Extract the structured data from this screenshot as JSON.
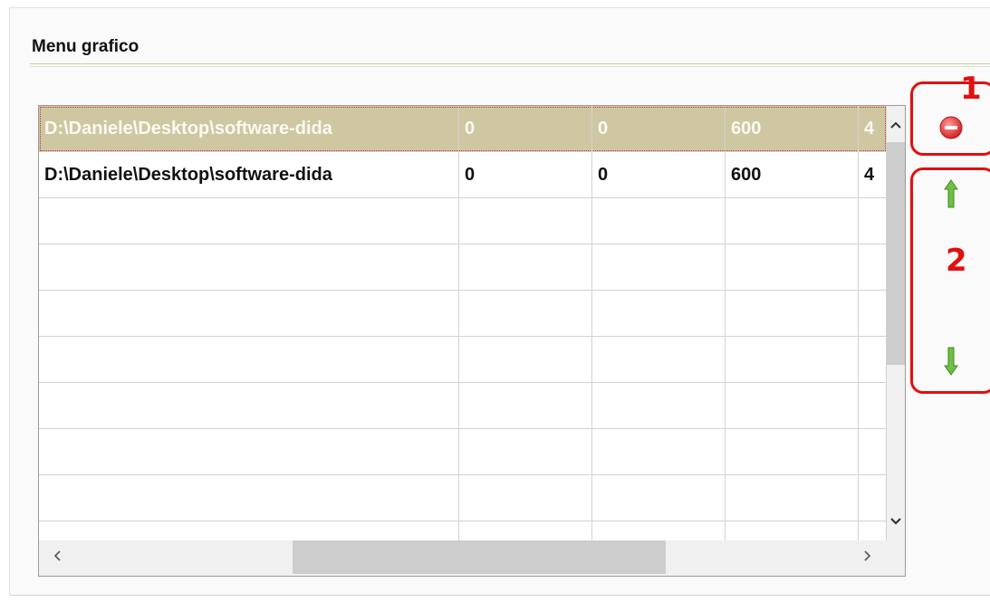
{
  "group_title": "Menu grafico",
  "grid": {
    "rows": [
      {
        "path": "D:\\Daniele\\Desktop\\software-dida",
        "c1": "0",
        "c2": "0",
        "c3": "600",
        "c4": "4"
      },
      {
        "path": "D:\\Daniele\\Desktop\\software-dida",
        "c1": "0",
        "c2": "0",
        "c3": "600",
        "c4": "4"
      }
    ],
    "selected_row": 0
  },
  "scrollbars": {
    "up": "^",
    "down": "v",
    "left": "<",
    "right": ">"
  },
  "annotations": {
    "box1_label": "1",
    "box2_label": "2",
    "color": "#e01010"
  },
  "icons": {
    "remove": "remove-icon",
    "move_up": "arrow-up-icon",
    "move_down": "arrow-down-icon"
  }
}
